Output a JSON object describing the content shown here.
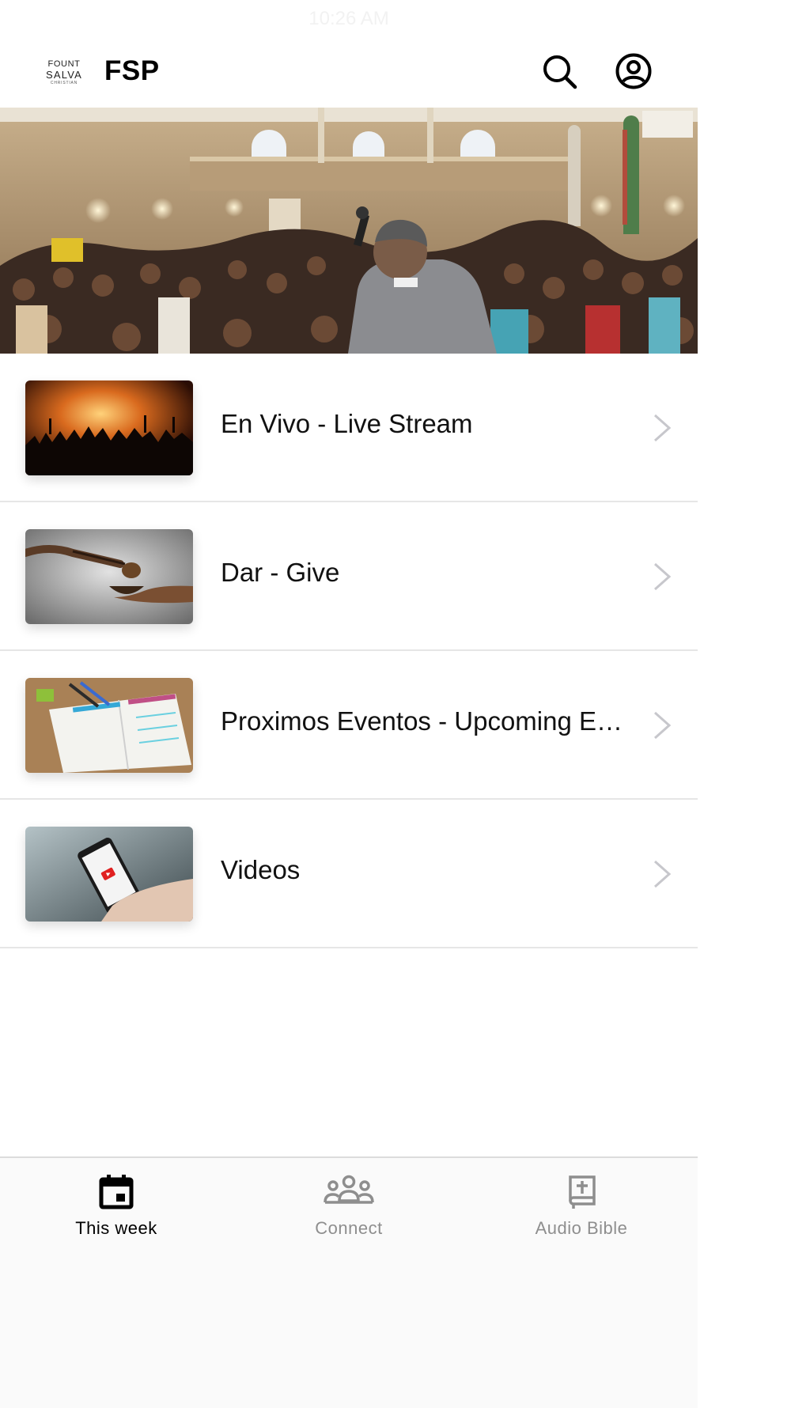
{
  "status_bar": {
    "time": "10:26 AM"
  },
  "header": {
    "logo": {
      "line1": "FOUNT",
      "line2": "SALVA",
      "line3": "CHRISTIAN"
    },
    "title": "FSP",
    "search_icon": "search-icon",
    "account_icon": "account-circle-icon"
  },
  "hero": {
    "image": "congregation-worship-photo"
  },
  "list": {
    "items": [
      {
        "label": "En Vivo - Live Stream",
        "thumb": "concert-crowd-photo"
      },
      {
        "label": "Dar - Give",
        "thumb": "offering-bowl-photo"
      },
      {
        "label": "Proximos Eventos - Upcoming Events",
        "thumb": "planner-notebook-photo"
      },
      {
        "label": "Videos",
        "thumb": "phone-video-photo"
      }
    ]
  },
  "tabs": [
    {
      "label": "This week",
      "icon": "calendar-icon",
      "active": true
    },
    {
      "label": "Connect",
      "icon": "people-icon",
      "active": false
    },
    {
      "label": "Audio Bible",
      "icon": "bible-icon",
      "active": false
    }
  ],
  "colors": {
    "active_tab": "#000000",
    "inactive_tab": "#8e8e8e",
    "divider": "#e6e6e6",
    "chevron": "#c7c7cc"
  }
}
